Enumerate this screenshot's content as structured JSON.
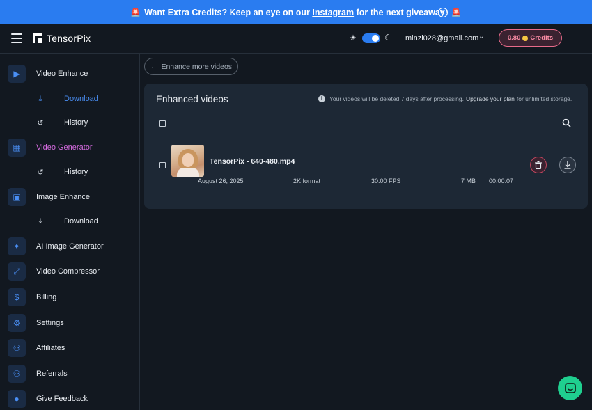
{
  "banner": {
    "text_before": "Want Extra Credits? Keep an eye on our",
    "link": "Instagram",
    "text_after": "for the next giveaway!",
    "close_glyph": "✕"
  },
  "header": {
    "brand": "TensorPix",
    "email": "minzi028@gmail.com",
    "credits_value": "0.80",
    "credits_label": "Credits",
    "theme_dark": true
  },
  "sidebar": {
    "video_enhance": "Video Enhance",
    "download_1": "Download",
    "history_1": "History",
    "video_generator": "Video Generator",
    "history_2": "History",
    "image_enhance": "Image Enhance",
    "download_2": "Download",
    "ai_image_generator": "AI Image Generator",
    "video_compressor": "Video Compressor",
    "billing": "Billing",
    "settings": "Settings",
    "affiliates": "Affiliates",
    "referrals": "Referrals",
    "give_feedback": "Give Feedback"
  },
  "main": {
    "back_label": "Enhance more videos",
    "panel_title": "Enhanced videos",
    "notice_before": "Your videos will be deleted 7 days after processing.",
    "notice_link": "Upgrade your plan",
    "notice_after": "for unlimited storage.",
    "video": {
      "filename": "TensorPix - 640-480.mp4",
      "date": "August 26, 2025",
      "format": "2K format",
      "fps": "30.00 FPS",
      "size": "7 MB",
      "duration": "00:00:07"
    }
  },
  "colors": {
    "accent": "#2a7cf0",
    "active_nav": "#4a8ff5",
    "video_generator": "#d66be0",
    "credits_border": "#e86b8a",
    "chat_button": "#1fcf8f"
  }
}
